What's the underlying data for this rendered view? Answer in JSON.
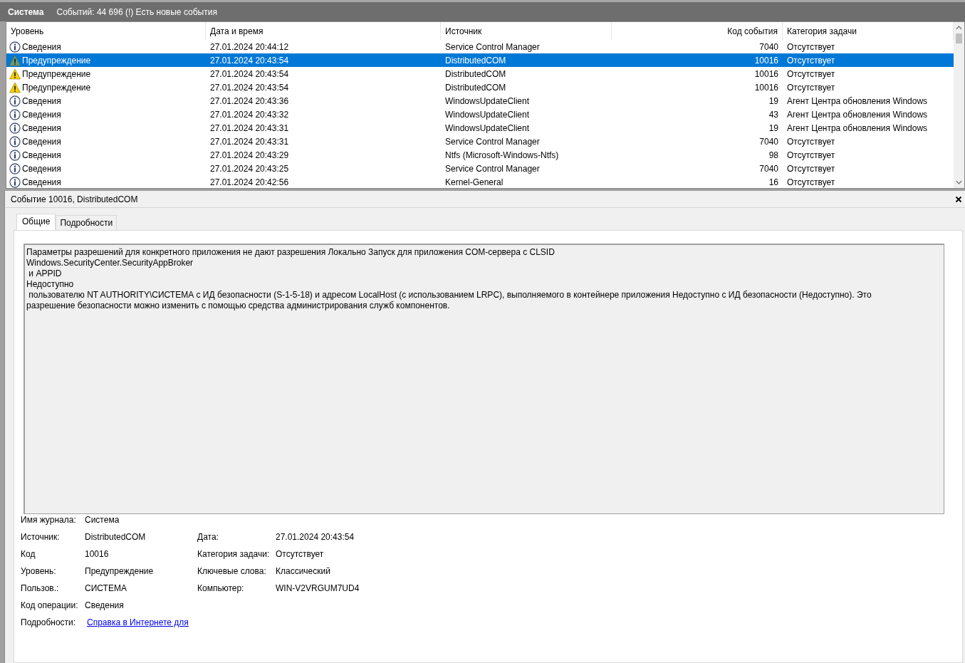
{
  "title_bar": {
    "title": "Система",
    "info": "Событий: 44 696 (!) Есть новые события"
  },
  "table": {
    "columns": [
      "Уровень",
      "Дата и время",
      "Источник",
      "Код события",
      "Категория задачи"
    ],
    "rows": [
      {
        "kind": "info",
        "level": "Сведения",
        "date": "27.01.2024 20:44:12",
        "source": "Service Control Manager",
        "code": "7040",
        "category": "Отсутствует",
        "selected": false
      },
      {
        "kind": "warning",
        "level": "Предупреждение",
        "date": "27.01.2024 20:43:54",
        "source": "DistributedCOM",
        "code": "10016",
        "category": "Отсутствует",
        "selected": true
      },
      {
        "kind": "warning",
        "level": "Предупреждение",
        "date": "27.01.2024 20:43:54",
        "source": "DistributedCOM",
        "code": "10016",
        "category": "Отсутствует",
        "selected": false
      },
      {
        "kind": "warning",
        "level": "Предупреждение",
        "date": "27.01.2024 20:43:54",
        "source": "DistributedCOM",
        "code": "10016",
        "category": "Отсутствует",
        "selected": false
      },
      {
        "kind": "info",
        "level": "Сведения",
        "date": "27.01.2024 20:43:36",
        "source": "WindowsUpdateClient",
        "code": "19",
        "category": "Агент Центра обновления Windows",
        "selected": false
      },
      {
        "kind": "info",
        "level": "Сведения",
        "date": "27.01.2024 20:43:32",
        "source": "WindowsUpdateClient",
        "code": "43",
        "category": "Агент Центра обновления Windows",
        "selected": false
      },
      {
        "kind": "info",
        "level": "Сведения",
        "date": "27.01.2024 20:43:31",
        "source": "WindowsUpdateClient",
        "code": "19",
        "category": "Агент Центра обновления Windows",
        "selected": false
      },
      {
        "kind": "info",
        "level": "Сведения",
        "date": "27.01.2024 20:43:31",
        "source": "Service Control Manager",
        "code": "7040",
        "category": "Отсутствует",
        "selected": false
      },
      {
        "kind": "info",
        "level": "Сведения",
        "date": "27.01.2024 20:43:29",
        "source": "Ntfs (Microsoft-Windows-Ntfs)",
        "code": "98",
        "category": "Отсутствует",
        "selected": false
      },
      {
        "kind": "info",
        "level": "Сведения",
        "date": "27.01.2024 20:43:25",
        "source": "Service Control Manager",
        "code": "7040",
        "category": "Отсутствует",
        "selected": false
      },
      {
        "kind": "info",
        "level": "Сведения",
        "date": "27.01.2024 20:42:56",
        "source": "Kernel-General",
        "code": "16",
        "category": "Отсутствует",
        "selected": false
      }
    ]
  },
  "detail": {
    "title": "Событие 10016, DistributedCOM",
    "tabs": [
      {
        "label": "Общие",
        "selected": true
      },
      {
        "label": "Подробности",
        "selected": false
      }
    ],
    "message": [
      "Параметры разрешений для конкретного приложения не дают разрешения Локально Запуск для приложения COM-сервера с CLSID",
      "Windows.SecurityCenter.SecurityAppBroker",
      " и APPID",
      "Недоступно",
      " пользователю NT AUTHORITY\\СИСТЕМА с ИД безопасности (S-1-5-18) и адресом LocalHost (с использованием LRPC), выполняемого в контейнере приложения Недоступно с ИД безопасности (Недоступно). Это разрешение безопасности можно изменить с помощью средства администрирования служб компонентов."
    ],
    "fields": [
      {
        "label": "Имя журнала:",
        "value": "Система"
      },
      {
        "label": "Источник:",
        "value": "DistributedCOM",
        "label2": "Дата:",
        "value2": "27.01.2024 20:43:54"
      },
      {
        "label": "Код",
        "value": "10016",
        "label2": "Категория задачи:",
        "value2": "Отсутствует"
      },
      {
        "label": "Уровень:",
        "value": "Предупреждение",
        "label2": "Ключевые слова:",
        "value2": "Классический"
      },
      {
        "label": "Пользов.:",
        "value": "СИСТЕМА",
        "label2": "Компьютер:",
        "value2": "WIN-V2VRGUM7UD4"
      },
      {
        "label": "Код операции:",
        "value": "Сведения"
      },
      {
        "label": "Подробности:",
        "value": "Справка в Интернете для ",
        "kind": "link"
      }
    ]
  }
}
